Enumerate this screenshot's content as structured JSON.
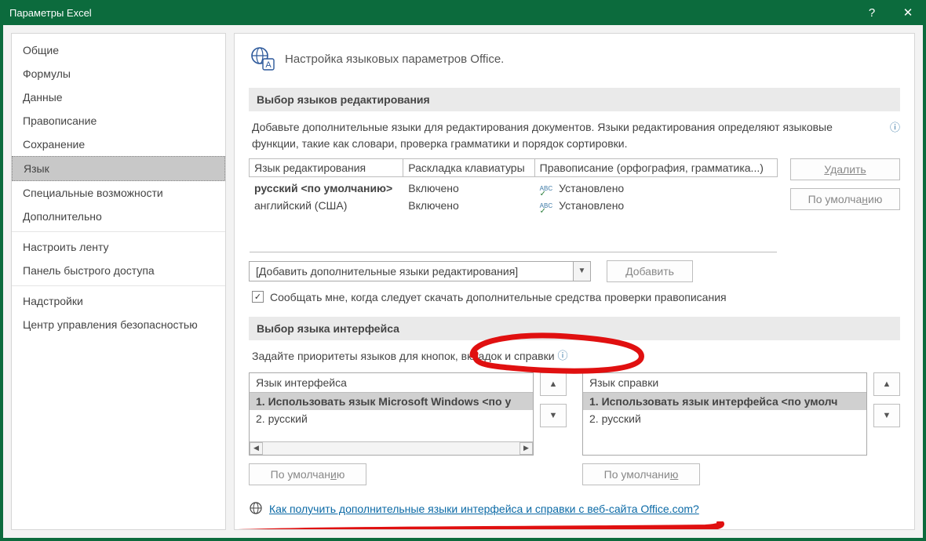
{
  "titlebar": {
    "title": "Параметры Excel",
    "help": "?",
    "close": "✕"
  },
  "sidebar": {
    "items": [
      "Общие",
      "Формулы",
      "Данные",
      "Правописание",
      "Сохранение",
      "Язык",
      "Специальные возможности",
      "Дополнительно",
      "Настроить ленту",
      "Панель быстрого доступа",
      "Надстройки",
      "Центр управления безопасностью"
    ],
    "selected_index": 5
  },
  "page": {
    "header": "Настройка языковых параметров Office.",
    "section_editing": {
      "title": "Выбор языков редактирования",
      "description": "Добавьте дополнительные языки для редактирования документов. Языки редактирования определяют языковые функции, такие как словари, проверка грамматики и порядок сортировки.",
      "columns": {
        "lang": "Язык редактирования",
        "layout": "Раскладка клавиатуры",
        "spelling": "Правописание (орфография, грамматика...)"
      },
      "rows": [
        {
          "lang": "русский <по умолчанию>",
          "bold": true,
          "layout": "Включено",
          "spelling": "Установлено"
        },
        {
          "lang": "английский (США)",
          "bold": false,
          "layout": "Включено",
          "spelling": "Установлено"
        }
      ],
      "buttons": {
        "remove": "Удалить",
        "default": "По умолчанию"
      },
      "add_dropdown": "[Добавить дополнительные языки редактирования]",
      "add_button": "Добавить",
      "notify_checkbox": "Сообщать мне, когда следует скачать дополнительные средства проверки правописания",
      "notify_checked": true
    },
    "section_ui": {
      "title": "Выбор языка интерфейса",
      "description": "Задайте приоритеты языков для кнопок, вкладок и справки",
      "left": {
        "header": "Язык интерфейса",
        "items": [
          "Использовать язык Microsoft Windows <по у",
          "русский"
        ],
        "default_button": "По умолчанию"
      },
      "right": {
        "header": "Язык справки",
        "items": [
          "Использовать язык интерфейса <по умолч",
          "русский"
        ],
        "default_button": "По умолчанию"
      },
      "link": "Как получить дополнительные языки интерфейса и справки с веб-сайта Office.com?"
    }
  }
}
